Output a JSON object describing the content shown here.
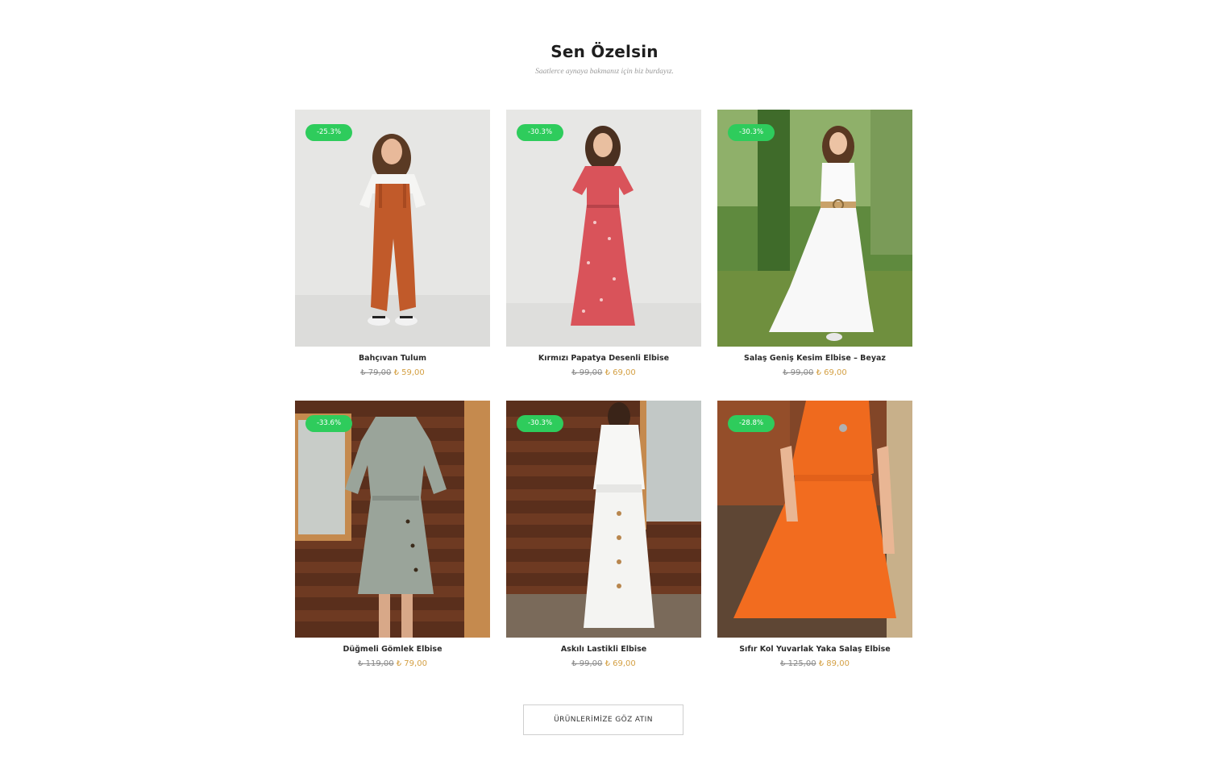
{
  "section": {
    "title": "Sen Özelsin",
    "subtitle": "Saatlerce aynaya bakmanız için biz burdayız."
  },
  "products": [
    {
      "name": "Bahçıvan Tulum",
      "old_price": "₺ 79,00",
      "new_price": "₺ 59,00",
      "discount": "-25.3%",
      "image": "woman-orange-overalls-photo"
    },
    {
      "name": "Kırmızı Papatya Desenli Elbise",
      "old_price": "₺ 99,00",
      "new_price": "₺ 69,00",
      "discount": "-30.3%",
      "image": "woman-red-floral-dress-photo"
    },
    {
      "name": "Salaş Geniş Kesim Elbise – Beyaz",
      "old_price": "₺ 99,00",
      "new_price": "₺ 69,00",
      "discount": "-30.3%",
      "image": "woman-white-dress-garden-photo"
    },
    {
      "name": "Düğmeli Gömlek Elbise",
      "old_price": "₺ 119,00",
      "new_price": "₺ 79,00",
      "discount": "-33.6%",
      "image": "woman-grey-shirt-dress-photo"
    },
    {
      "name": "Askılı Lastikli Elbise",
      "old_price": "₺ 99,00",
      "new_price": "₺ 69,00",
      "discount": "-30.3%",
      "image": "woman-white-strap-dress-photo"
    },
    {
      "name": "Sıfır Kol Yuvarlak Yaka Salaş Elbise",
      "old_price": "₺ 125,00",
      "new_price": "₺ 89,00",
      "discount": "-28.8%",
      "image": "woman-orange-dress-photo"
    }
  ],
  "cta": {
    "label": "ÜRÜNLERİMİZE GÖZ ATIN"
  },
  "colors": {
    "badge": "#2ecc5c",
    "sale_price": "#d4a044",
    "old_price": "#8a8a8a"
  }
}
